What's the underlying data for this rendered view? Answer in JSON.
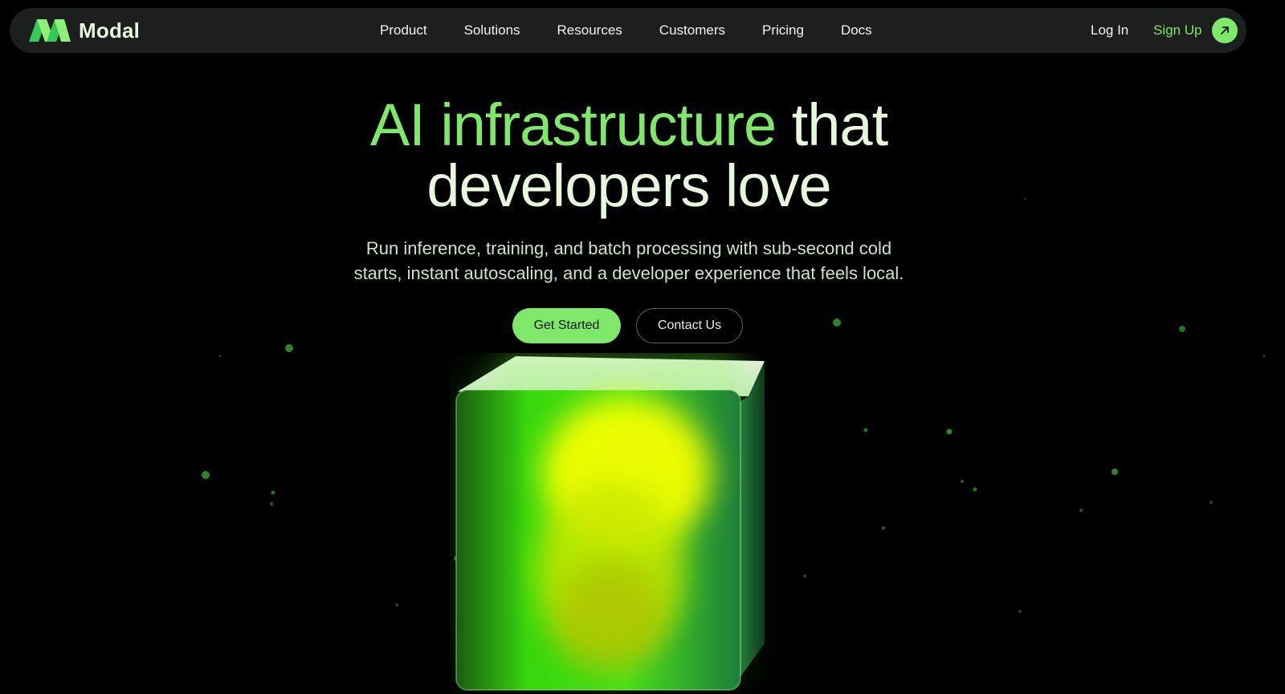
{
  "nav": {
    "brand": "Modal",
    "items": [
      {
        "label": "Product"
      },
      {
        "label": "Solutions"
      },
      {
        "label": "Resources"
      },
      {
        "label": "Customers"
      },
      {
        "label": "Pricing"
      },
      {
        "label": "Docs"
      }
    ],
    "login": "Log In",
    "signup": "Sign Up"
  },
  "hero": {
    "title_accent": "AI infrastructure",
    "title_rest_1": "that",
    "title_rest_2": "developers love",
    "subtitle_line1": "Run inference, training, and batch processing with sub-second cold",
    "subtitle_line2": "starts, instant autoscaling, and a developer experience that feels local.",
    "primary_button": "Get Started",
    "secondary_button": "Contact Us"
  },
  "colors": {
    "accent": "#7fe86a",
    "nav_background": "#1d1f1e",
    "page_background": "#000000",
    "heading_light": "#e6f7dd"
  },
  "icons": {
    "logo": "modal-logo-icon",
    "signup": "arrow-up-right-icon"
  }
}
